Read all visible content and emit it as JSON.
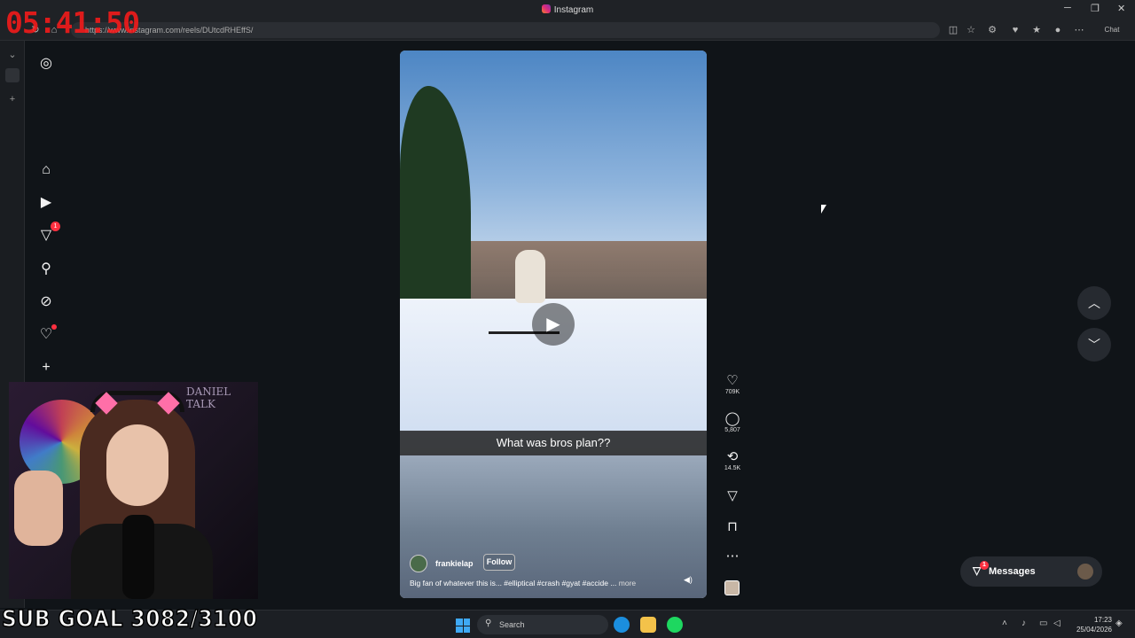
{
  "browser": {
    "window_title": "Instagram",
    "url": "https://www.instagram.com/reels/DUtcdRHEffS/",
    "profile_chat_label": "Chat"
  },
  "overlay": {
    "timer": "05:41:50",
    "sub_goal": "SUB GOAL 3082/3100",
    "wall_text": "DANIEL TALK"
  },
  "sidebar": {
    "notifications_badge": "1"
  },
  "reel": {
    "caption": "What was bros plan??",
    "author": "frankielap",
    "follow_label": "Follow",
    "description": "Big fan of whatever this is... #elliptical #crash #gyat #accide ...",
    "more_label": "more"
  },
  "actions": {
    "likes": "709K",
    "comments": "5,807",
    "reposts": "14.5K"
  },
  "messages": {
    "label": "Messages",
    "badge": "1"
  },
  "taskbar": {
    "search_placeholder": "Search",
    "time": "17:23",
    "date": "25/04/2026"
  },
  "colors": {
    "timer": "#ff1a1a",
    "badge": "#ff3040",
    "background": "#101418"
  }
}
